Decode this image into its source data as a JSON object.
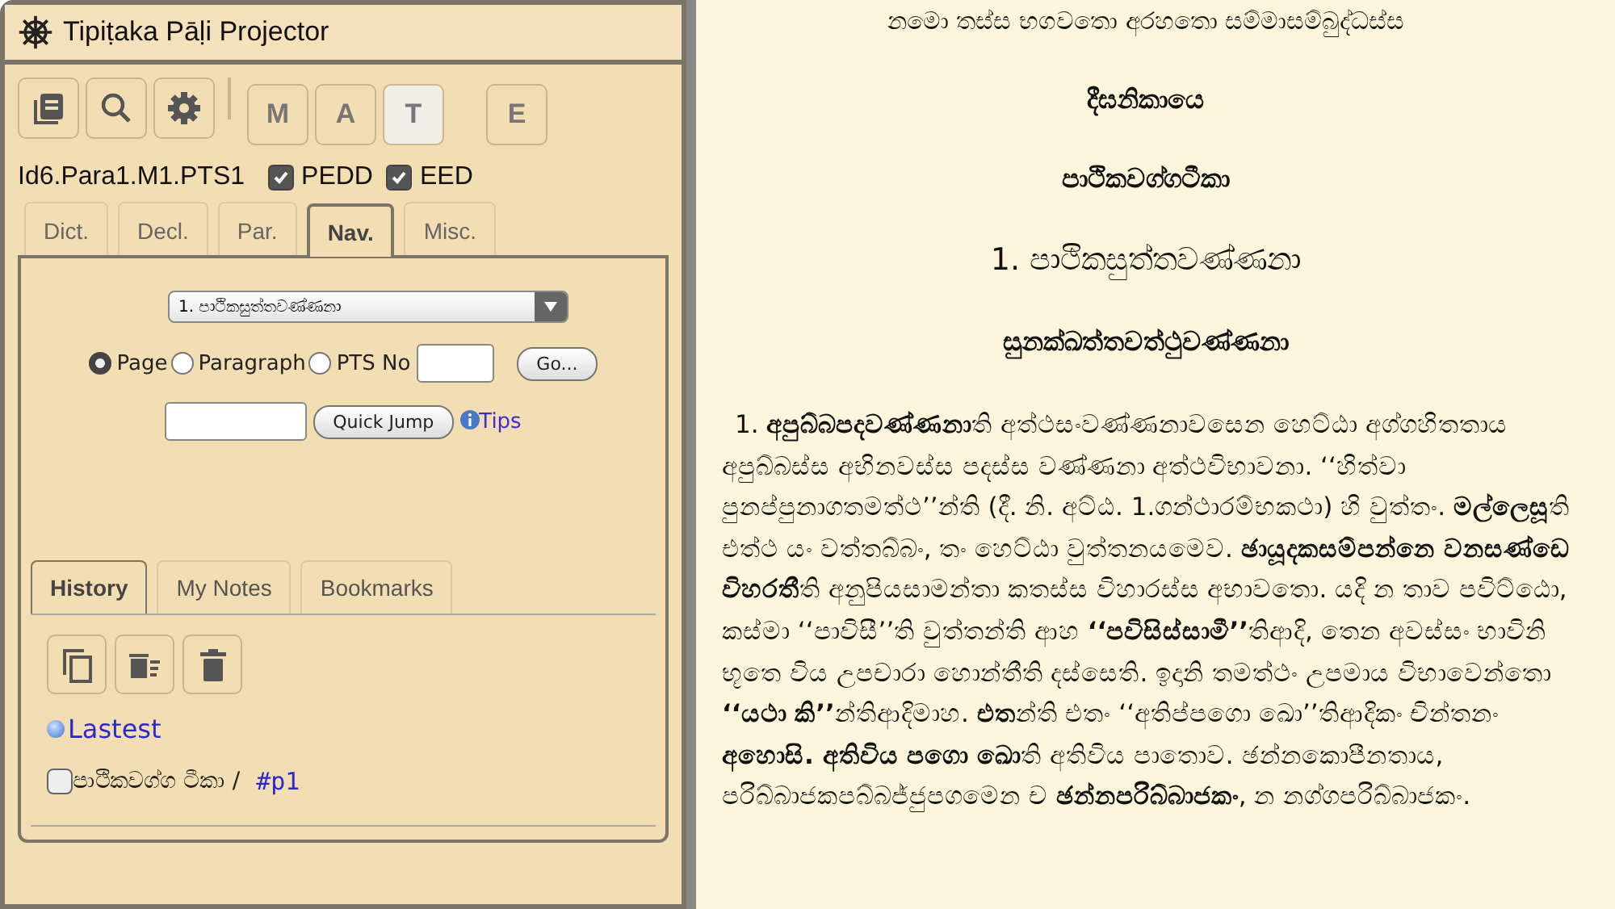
{
  "window": {
    "title": "Tipiṭaka Pāḷi Projector"
  },
  "toolbar": {
    "icon_buttons": [
      {
        "kind": "book"
      },
      {
        "kind": "search"
      },
      {
        "kind": "settings"
      }
    ],
    "letter_buttons": [
      {
        "label": "M",
        "selected": false
      },
      {
        "label": "A",
        "selected": false
      },
      {
        "label": "T",
        "selected": true
      },
      {
        "label": "E",
        "selected": false
      }
    ]
  },
  "status": {
    "reference": "Id6.Para1.M1.PTS1",
    "checkboxes": [
      {
        "label": "PEDD",
        "checked": true
      },
      {
        "label": "EED",
        "checked": true
      }
    ]
  },
  "tabs": [
    {
      "label": "Dict.",
      "selected": false
    },
    {
      "label": "Decl.",
      "selected": false
    },
    {
      "label": "Par.",
      "selected": false
    },
    {
      "label": "Nav.",
      "selected": true
    },
    {
      "label": "Misc.",
      "selected": false
    }
  ],
  "nav": {
    "dropdown": "1. පාථිකසුත්තවණ්ණනා",
    "radios": [
      {
        "label": "Page",
        "selected": true
      },
      {
        "label": "Paragraph",
        "selected": false
      },
      {
        "label": "PTS No",
        "selected": false
      }
    ],
    "go_button": "Go...",
    "quick_jump_button": "Quick Jump",
    "tips_link": "Tips"
  },
  "lower_tabs": [
    {
      "label": "History",
      "selected": true
    },
    {
      "label": "My Notes",
      "selected": false
    },
    {
      "label": "Bookmarks",
      "selected": false
    }
  ],
  "history": {
    "actions": [
      {
        "kind": "copy"
      },
      {
        "kind": "clear-list"
      },
      {
        "kind": "delete"
      }
    ],
    "latest_link": "Lastest",
    "entries": [
      {
        "checked": false,
        "title": "පාථිකවග්ග ටීකා /",
        "link": "#p1"
      }
    ]
  },
  "reader": {
    "headings": [
      {
        "kind": "invocation",
        "text": "නමො තස්ස භගවතො අරහතො සම්මාසම්බුද්ධස්ස"
      },
      {
        "kind": "title",
        "text": "දීඝනිකායෙ"
      },
      {
        "kind": "title",
        "text": "පාථිකවග්ගටීකා"
      },
      {
        "kind": "chapter",
        "text": "1. පාථිකසුත්තවණ්ණනා"
      },
      {
        "kind": "title",
        "text": "සුනක්ඛත්තවත්ථුවණ්ණනා"
      }
    ],
    "paragraph": "1. **අපුබ්බපදවණ්ණනා**ති අත්ථසංවණ්ණනාවසෙන හෙට්ඨා අග්ගහිතතාය අපුබ්බස්ස අභිනවස්ස පදස්ස වණ්ණනා අත්ථවිභාවනා. ‘‘හිත්වා පුනප්පුනාගතමත්ථ’’න්ති (දී. නි. අට්ඨ. 1.ගන්ථාරම්භකථා) හි වුත්තං. **මල්ලෙසූ**ති එත්ථ යං වත්තබ්බං, තං හෙට්ඨා වුත්තනයමෙව. **ඡායූදකසම්පන්නෙ වනසණ්ඩෙ විහරතී**ති අනුපියසාමන්තා කතස්ස විහාරස්ස අභාවතො. යදි න තාව පවිට්ඨො, කස්මා ‘‘පාවිසී’’ති වුත්තන්ති ආහ **‘‘පවිසිස්සාමී’’**තිආදි, තෙන අවස්සං භාවිනි භූතෙ විය උපචාරා හොන්තීති දස්සෙති. ඉදානි තමත්ථං උපමාය විභාවෙන්තො **‘‘යථා කි’’**න්තිආදිමාහ. **එත**න්ති එතං ‘‘අතිප්පගො ඛො’’තිආදිකං චින්තනං **අහොසි. අතිවිය පගො ඛො**ති අතිවිය පාතොව. ඡන්නකොපීනතාය, පරිබ්බාජකපබ්බජ්ජුපගමෙන ච **ඡන්නපරිබ්බාජකං**, න නග්ගපරිබ්බාජකං."
  }
}
